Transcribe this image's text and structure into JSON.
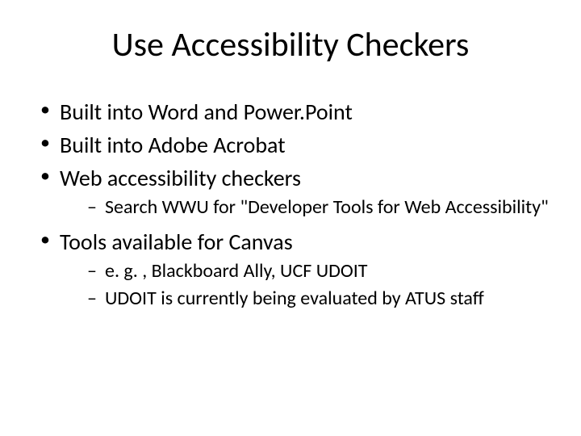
{
  "title": "Use Accessibility Checkers",
  "bullets": [
    {
      "text": "Built into Word and Power.Point",
      "sub": []
    },
    {
      "text": "Built into Adobe Acrobat",
      "sub": []
    },
    {
      "text": "Web accessibility checkers",
      "sub": [
        "Search WWU for \"Developer Tools for Web Accessibility\""
      ]
    },
    {
      "text": "Tools available for Canvas",
      "sub": [
        "e. g. , Blackboard Ally, UCF UDOIT",
        "UDOIT is currently being evaluated by ATUS staff"
      ]
    }
  ]
}
